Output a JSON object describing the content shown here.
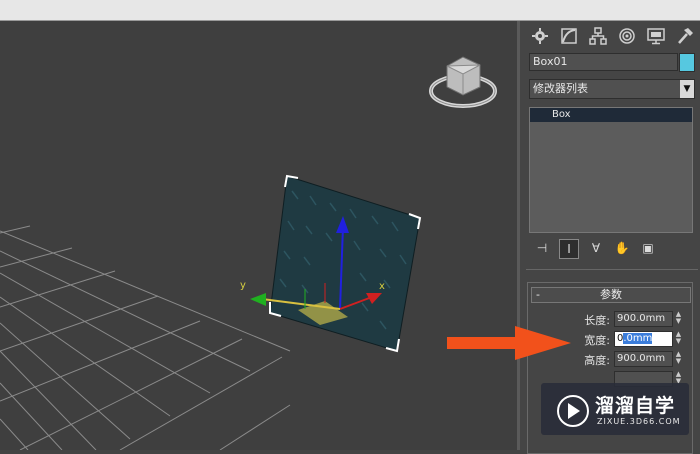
{
  "command_panel": {
    "tabs": [
      {
        "name": "create-tab",
        "icon": "gear-icon"
      },
      {
        "name": "modify-tab",
        "icon": "modify-bend-icon"
      },
      {
        "name": "hierarchy-tab",
        "icon": "hierarchy-icon"
      },
      {
        "name": "motion-tab",
        "icon": "motion-icon"
      },
      {
        "name": "display-tab",
        "icon": "monitor-icon"
      },
      {
        "name": "utilities-tab",
        "icon": "hammer-icon"
      }
    ],
    "object_name": "Box01",
    "object_color": "#56c8e0",
    "modifier_list": "修改器列表",
    "stack_items": [
      "Box"
    ],
    "stack_tools": [
      {
        "name": "pin-stack-icon",
        "glyph": "⊣"
      },
      {
        "name": "show-end-result-icon",
        "glyph": "I"
      },
      {
        "name": "make-unique-icon",
        "glyph": "∀"
      },
      {
        "name": "remove-modifier-icon",
        "glyph": "✋"
      },
      {
        "name": "configure-modifier-sets-icon",
        "glyph": "▣"
      }
    ]
  },
  "parameters": {
    "title": "参数",
    "length_label": "长度:",
    "length_value": "900.0mm",
    "width_label": "宽度:",
    "width_value_lead": "0",
    "width_value_selected": ".0mm",
    "height_label": "高度:",
    "height_value": "900.0mm"
  },
  "viewport": {
    "axis_x": "x",
    "axis_y": "y"
  },
  "watermark": {
    "title": "溜溜自学",
    "subtitle": "ZIXUE.3D66.COM"
  },
  "colors": {
    "accent_arrow": "#f2511b",
    "selection_blue": "#3b7ddb"
  }
}
